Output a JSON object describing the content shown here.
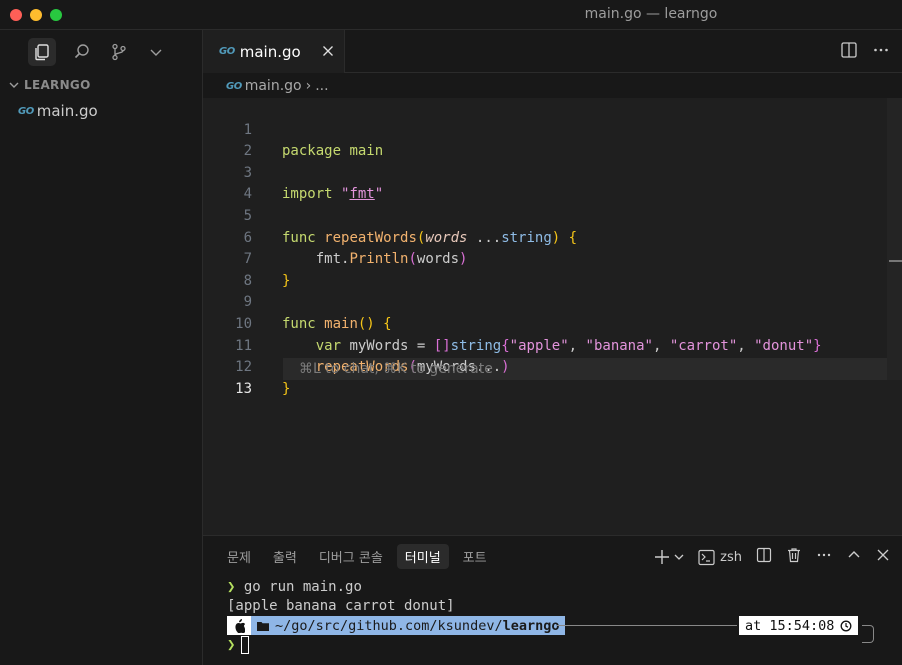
{
  "window": {
    "title": "main.go — learngo"
  },
  "colors": {
    "bg": "#181818",
    "editor_bg": "#1f1f1f",
    "accent_prompt": "#b5e05f",
    "path_segment": "#8fb6e6"
  },
  "sidebar": {
    "icons": [
      "files-icon",
      "search-icon",
      "source-control-icon",
      "chevron-down-icon"
    ],
    "explorer_title": "LEARNGO",
    "file_badge": "GO",
    "file_name": "main.go"
  },
  "tabs": [
    {
      "badge": "GO",
      "label": "main.go"
    }
  ],
  "breadcrumb": {
    "badge": "GO",
    "file": "main.go",
    "separator": "›",
    "rest": "..."
  },
  "editor": {
    "line_numbers": [
      "1",
      "2",
      "3",
      "4",
      "5",
      "6",
      "7",
      "8",
      "9",
      "10",
      "11",
      "12",
      "13"
    ],
    "active_line": "13",
    "hint": "⌘L to chat, ⌘K to generate",
    "code": {
      "l1_kw": "package",
      "l1_name": "main",
      "l3_kw": "import",
      "l3_q1": "\"",
      "l3_pkg": "fmt",
      "l3_q2": "\"",
      "l5_kw": "func",
      "l5_fn": "repeatWords",
      "l5_open": "(",
      "l5_param": "words",
      "l5_dots": " ...",
      "l5_type": "string",
      "l5_close": ")",
      "l5_brace": "{",
      "l6_pkg": "fmt.",
      "l6_fn": "Println",
      "l6_open": "(",
      "l6_arg": "words",
      "l6_close": ")",
      "l7_brace": "}",
      "l9_kw": "func",
      "l9_fn": "main",
      "l9_parens": "()",
      "l9_brace": "{",
      "l10_kw": "var",
      "l10_name": "myWords",
      "l10_eq": "=",
      "l10_sl": "[]",
      "l10_type": "string",
      "l10_open": "{",
      "l10_s1": "\"apple\"",
      "l10_c1": ", ",
      "l10_s2": "\"banana\"",
      "l10_c2": ", ",
      "l10_s3": "\"carrot\"",
      "l10_c3": ", ",
      "l10_s4": "\"donut\"",
      "l10_close": "}",
      "l11_fn": "repeatWords",
      "l11_open": "(",
      "l11_arg": "myWords...",
      "l11_close": ")",
      "l12_brace": "}"
    }
  },
  "panel": {
    "tabs": [
      "문제",
      "출력",
      "디버그 콘솔",
      "터미널",
      "포트"
    ],
    "active_tab": "터미널",
    "shell": "zsh",
    "terminal": {
      "command": "go run main.go",
      "output": "[apple banana carrot donut]",
      "path_prefix": "~/go/src/github.com/ksundev/",
      "path_bold": "learngo",
      "time": "at 15:54:08"
    }
  }
}
